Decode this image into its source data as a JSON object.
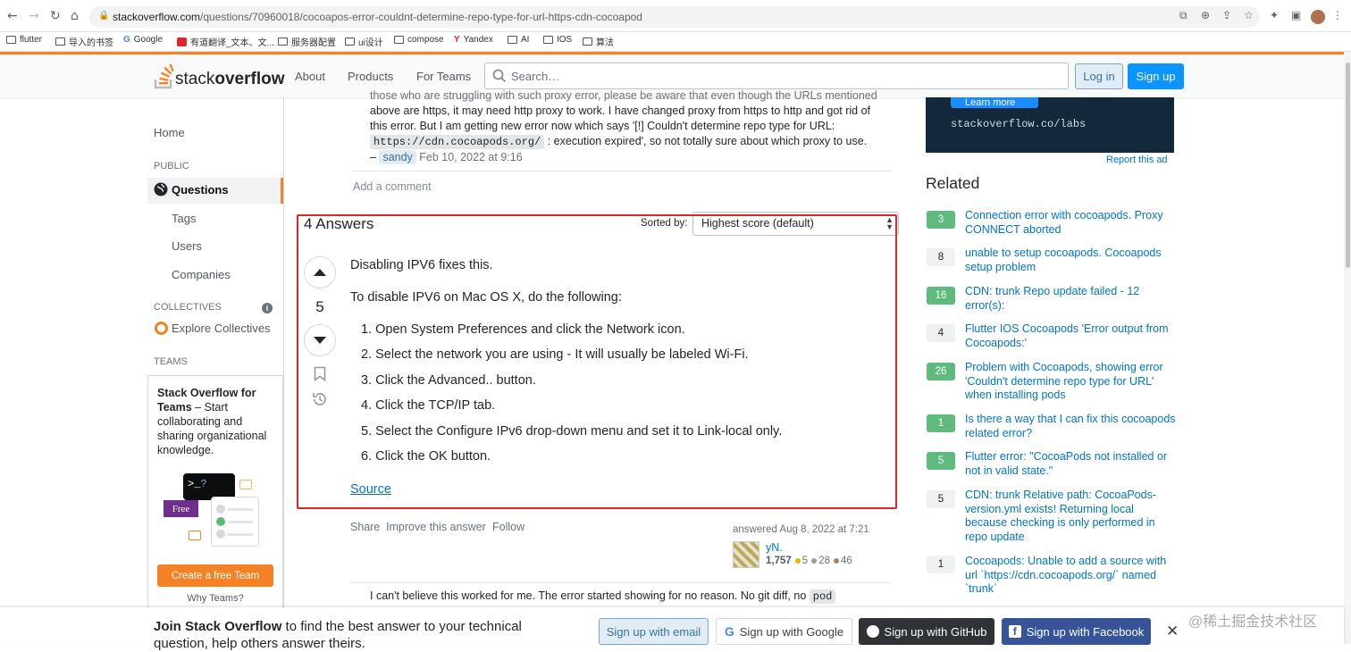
{
  "browser": {
    "url_host": "stackoverflow.com",
    "url_path": "/questions/70960018/cocoapos-error-couldnt-determine-repo-type-for-url-https-cdn-cocoapod",
    "bookmarks": [
      "flutter",
      "导入的书签",
      "Google",
      "有道翻译_文本、文...",
      "服务器配置",
      "ui设计",
      "compose",
      "Yandex",
      "AI",
      "IOS",
      "算法"
    ]
  },
  "header": {
    "logo_a": "stack",
    "logo_b": "overflow",
    "nav": [
      "About",
      "Products",
      "For Teams"
    ],
    "search_placeholder": "Search…",
    "login": "Log in",
    "signup": "Sign up"
  },
  "sidebar": {
    "home": "Home",
    "public": "PUBLIC",
    "questions": "Questions",
    "tags": "Tags",
    "users": "Users",
    "companies": "Companies",
    "collectives": "COLLECTIVES",
    "explore_collectives": "Explore Collectives",
    "teams": "TEAMS",
    "teams_title": "Stack Overflow for Teams",
    "teams_desc": " – Start collaborating and sharing organizational knowledge.",
    "free_badge": "Free",
    "create_team": "Create a free Team",
    "why_teams": "Why Teams?"
  },
  "comment": {
    "line0": "those who are struggling with such proxy error, please be aware that even though the URLs mentioned",
    "line1": "above are https, it may need http proxy to work. I have changed proxy from https to http and got rid of",
    "line2": "this error. But I am getting new error now which says '[!] Couldn't determine repo type for URL:",
    "code": "https://cdn.cocoapods.org/",
    "line3_rest": ": execution expired', so not totally sure about which proxy to use.",
    "dash": "–",
    "user": "sandy",
    "date": "Feb 10, 2022 at 9:16",
    "add_comment": "Add a comment"
  },
  "answers": {
    "count_label": "4 Answers",
    "sorted_by": "Sorted by:",
    "sort_value": "Highest score (default)",
    "vote_count": "5",
    "p1": "Disabling IPV6 fixes this.",
    "p2": "To disable IPV6 on Mac OS X, do the following:",
    "steps": [
      "1. Open System Preferences and click the Network icon.",
      "2. Select the network you are using - It will usually be labeled Wi-Fi.",
      "3. Click the Advanced.. button.",
      "4. Click the TCP/IP tab.",
      "5. Select the Configure IPv6 drop-down menu and set it to Link-local only.",
      "6. Click the OK button."
    ],
    "source": "Source",
    "menu": [
      "Share",
      "Improve this answer",
      "Follow"
    ],
    "answered": "answered Aug 8, 2022 at 7:21",
    "username": "yN.",
    "rep": "1,757",
    "gold": "5",
    "silver": "28",
    "bronze": "46",
    "next_comment": "I can't believe this worked for me. The error started showing for no reason. No git diff, no",
    "next_code": "pod"
  },
  "right": {
    "ad_button": "Learn more",
    "ad_url": "stackoverflow.co/labs",
    "report_ad": "Report this ad",
    "related_title": "Related",
    "related": [
      {
        "score": "3",
        "accepted": true,
        "title": "Connection error with cocoapods. Proxy CONNECT aborted"
      },
      {
        "score": "8",
        "accepted": false,
        "title": "unable to setup cocoapods. Cocoapods setup problem"
      },
      {
        "score": "16",
        "accepted": true,
        "title": "CDN: trunk Repo update failed - 12 error(s):"
      },
      {
        "score": "4",
        "accepted": false,
        "title": "Flutter IOS Cocoapods 'Error output from Cocoapods:'"
      },
      {
        "score": "26",
        "accepted": true,
        "title": "Problem with Cocoapods, showing error 'Couldn't determine repo type for URL' when installing pods"
      },
      {
        "score": "1",
        "accepted": true,
        "title": "Is there a way that I can fix this cocoapods related error?"
      },
      {
        "score": "5",
        "accepted": true,
        "title": "Flutter error: \"CocoaPods not installed or not in valid state.\""
      },
      {
        "score": "5",
        "accepted": false,
        "title": "CDN: trunk Relative path: CocoaPods-version.yml exists! Returning local because checking is only performed in repo update"
      },
      {
        "score": "1",
        "accepted": false,
        "title": "Cocoapods: Unable to add a source with url `https://cdn.cocoapods.org/` named `trunk`"
      }
    ]
  },
  "banner": {
    "bold": "Join Stack Overflow",
    "text": " to find the best answer to your technical question, help others answer theirs.",
    "email": "Sign up with email",
    "google": "Sign up with Google",
    "github": "Sign up with GitHub",
    "facebook": "Sign up with Facebook",
    "close": "✕",
    "watermark": "@稀土掘金技术社区"
  },
  "colors": {
    "accent": "#f48225",
    "link": "#0074cc",
    "highlight_box": "#e0262a",
    "accepted": "#5eba7d"
  }
}
